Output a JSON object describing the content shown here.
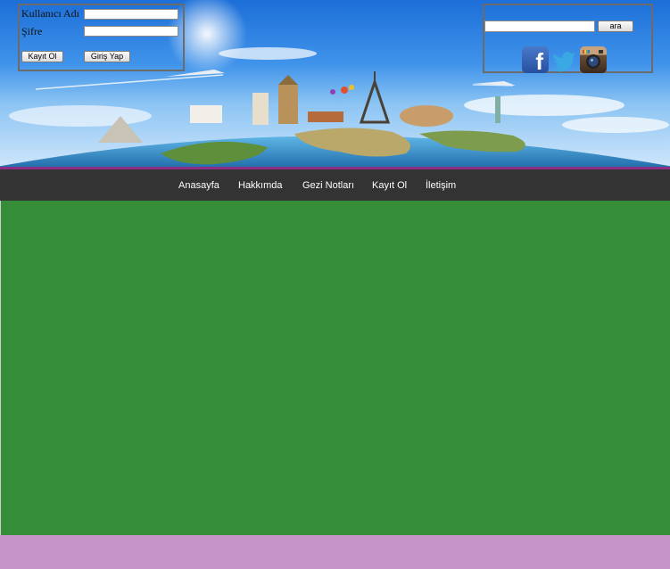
{
  "login": {
    "username_label": "Kullanıcı Adı",
    "username_value": "",
    "password_label": "Şifre",
    "password_value": "",
    "register_button": "Kayıt Ol",
    "login_button": "Giriş Yap"
  },
  "search": {
    "value": "",
    "button_label": "ara"
  },
  "social": {
    "facebook_icon": "facebook-icon",
    "twitter_icon": "twitter-icon",
    "instagram_icon": "instagram-icon",
    "facebook_glyph": "f"
  },
  "nav": {
    "items": [
      "Anasayfa",
      "Hakkımda",
      "Gezi Notları",
      "Kayıt Ol",
      "İletişim"
    ]
  },
  "colors": {
    "nav_bg": "#333333",
    "accent_line": "#8d2e86",
    "content_bg": "#358d38",
    "footer_bg": "#c593c6"
  }
}
